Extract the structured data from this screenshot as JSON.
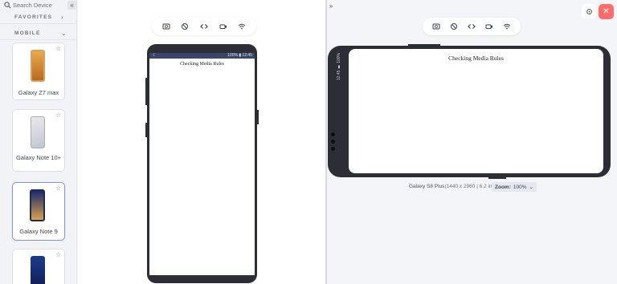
{
  "search": {
    "placeholder": "Search Device"
  },
  "sidebar": {
    "collapse_icon": "«",
    "favorites_label": "FAVORITES",
    "favorites_chevron": "›",
    "mobile_label": "MOBILE",
    "mobile_chevron": "⌄",
    "devices": [
      {
        "name": "Galaxy Z7 max"
      },
      {
        "name": "Galaxy Note 10+"
      },
      {
        "name": "Galaxy Note 9"
      },
      {
        "name": ""
      }
    ]
  },
  "expand_icon": "»",
  "toolbar": {
    "items": [
      "screenshot-icon",
      "rotate-icon",
      "code-icon",
      "video-icon",
      "wifi-icon"
    ]
  },
  "portrait": {
    "status_left": "☾",
    "status_right": "100% ▮ 12:45",
    "page_text": "Checking Media Rules"
  },
  "landscape": {
    "status_text": "12:45 ▮ 100%",
    "page_text": "Checking Media Rules"
  },
  "device_info": {
    "name": "Galaxy S8 Plus",
    "specs": "(1440 x 2960 | 6.2 in)"
  },
  "zoom": {
    "label": "Zoom:",
    "value": "100%",
    "chevron": "⌄"
  },
  "top_right": {
    "close_label": "✕"
  },
  "colors": {
    "accent_close": "#ff6c6c",
    "selected_border": "#7d8ff0",
    "statusbar": "#3b4469",
    "phone_body": "#2b2e35"
  }
}
